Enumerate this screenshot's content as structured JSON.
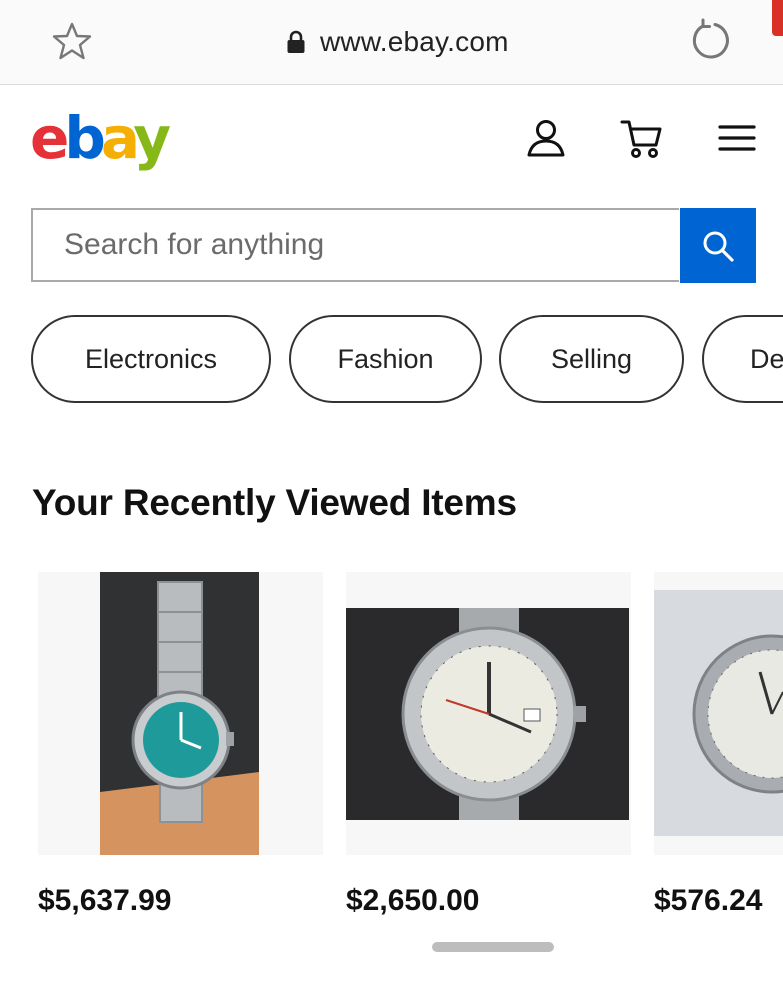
{
  "browser": {
    "url": "www.ebay.com",
    "icons": [
      "star-icon",
      "lock-icon",
      "reload-icon"
    ]
  },
  "header": {
    "logo_letters": [
      "e",
      "b",
      "a",
      "y"
    ],
    "logo_colors": [
      "#e53238",
      "#0064d2",
      "#f5af02",
      "#86b817"
    ],
    "icons": [
      "user-icon",
      "cart-icon",
      "menu-icon"
    ]
  },
  "search": {
    "placeholder": "Search for anything",
    "value": "",
    "button_color": "#0064d2"
  },
  "categories": [
    {
      "label": "Electronics"
    },
    {
      "label": "Fashion"
    },
    {
      "label": "Selling"
    },
    {
      "label": "De"
    }
  ],
  "recently_viewed": {
    "title": "Your Recently Viewed Items",
    "items": [
      {
        "price": "$5,637.99",
        "dial_color": "#1f9a9a"
      },
      {
        "price": "$2,650.00",
        "dial_color": "#ecebe2"
      },
      {
        "price": "$576.24",
        "dial_color": "#e9e9e3"
      }
    ]
  }
}
